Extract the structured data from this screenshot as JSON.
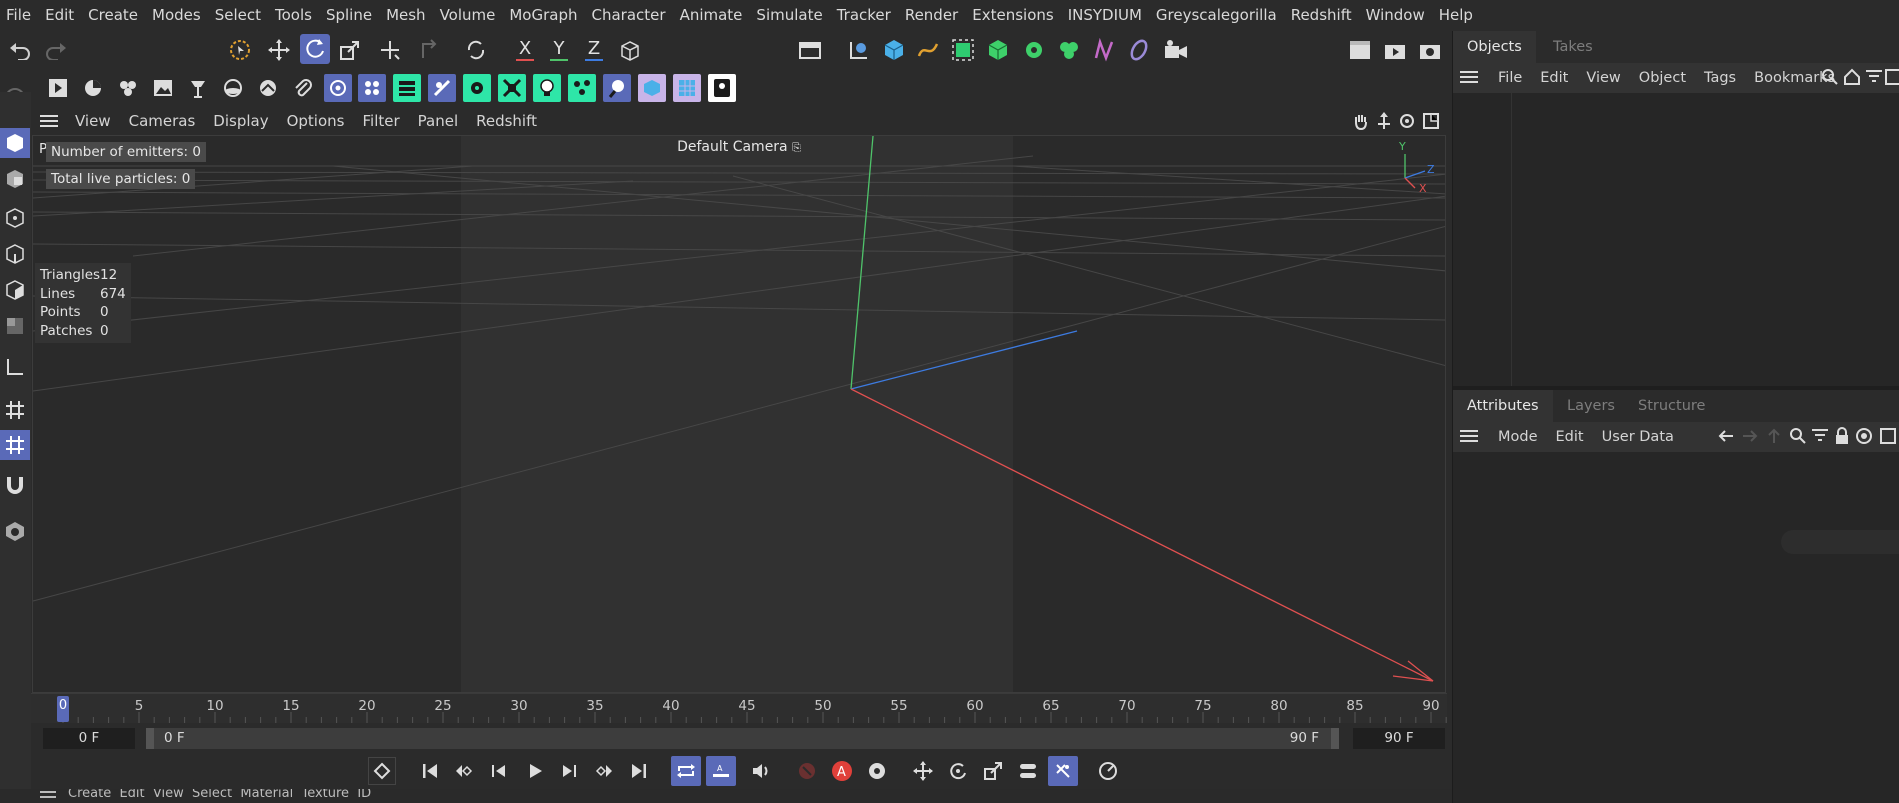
{
  "menubar": [
    "File",
    "Edit",
    "Create",
    "Modes",
    "Select",
    "Tools",
    "Spline",
    "Mesh",
    "Volume",
    "MoGraph",
    "Character",
    "Animate",
    "Simulate",
    "Tracker",
    "Render",
    "Extensions",
    "INSYDIUM",
    "Greyscalegorilla",
    "Redshift",
    "Window",
    "Help"
  ],
  "axis_buttons": {
    "x": "X",
    "y": "Y",
    "z": "Z"
  },
  "viewport_menu": [
    "View",
    "Cameras",
    "Display",
    "Options",
    "Filter",
    "Panel",
    "Redshift"
  ],
  "viewport": {
    "camera_label": "Default Camera",
    "view_letter": "P",
    "particles": {
      "emitters": "Number of emitters: 0",
      "live": "Total live particles: 0"
    },
    "stats": [
      {
        "label": "Triangles",
        "value": "12"
      },
      {
        "label": "Lines",
        "value": "674"
      },
      {
        "label": "Points",
        "value": "0"
      },
      {
        "label": "Patches",
        "value": "0"
      }
    ],
    "axis_gizmo": {
      "y": "Y",
      "z": "Z",
      "x": "X"
    }
  },
  "timeline": {
    "ticks": [
      "0",
      "5",
      "10",
      "15",
      "20",
      "25",
      "30",
      "35",
      "40",
      "45",
      "50",
      "55",
      "60",
      "65",
      "70",
      "75",
      "80",
      "85",
      "90"
    ],
    "current": "0"
  },
  "frame_fields": {
    "current": "0 F",
    "range_start": "0 F",
    "range_end": "90 F",
    "end": "90 F"
  },
  "bottom_strip": "Create  Edit  View  Select  Material  Texture  ID",
  "objects_panel": {
    "tabs": [
      "Objects",
      "Takes"
    ],
    "menu": [
      "File",
      "Edit",
      "View",
      "Object",
      "Tags",
      "Bookmarks"
    ]
  },
  "attributes_panel": {
    "tabs": [
      "Attributes",
      "Layers",
      "Structure"
    ],
    "menu": [
      "Mode",
      "Edit",
      "User Data"
    ]
  },
  "colors": {
    "accent": "#5a6ab8",
    "teal": "#2ee6a8",
    "x_axis": "#e05050",
    "y_axis": "#4fc36a",
    "z_axis": "#3d7be0"
  }
}
